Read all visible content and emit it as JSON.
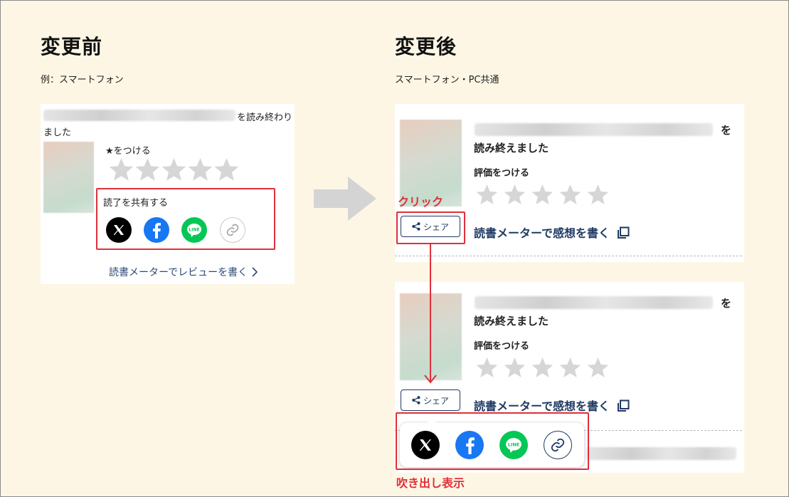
{
  "before": {
    "title": "変更前",
    "subtitle": "例：スマートフォン",
    "card": {
      "message_suffix": "を読み終わり",
      "message_line2": "ました",
      "rate_label": "★をつける",
      "share_label": "読了を共有する",
      "review_link": "読書メーターでレビューを書く"
    }
  },
  "after": {
    "title": "変更後",
    "subtitle": "スマートフォン・PC共通",
    "card": {
      "message_suffix": "を",
      "message_line2": "読み終えました",
      "rate_label": "評価をつける",
      "share_button": "シェア",
      "write_link": "読書メーターで感想を書く"
    },
    "click_label": "クリック",
    "balloon_label": "吹き出し表示"
  },
  "icons": [
    "x-icon",
    "facebook-icon",
    "line-icon",
    "link-icon",
    "share-icon",
    "star-icon",
    "copy-icon",
    "arrow-right-icon",
    "chevron-right-icon"
  ],
  "colors": {
    "background": "#fdf6e5",
    "highlight": "#e0303a",
    "link": "#1f3a63",
    "facebook": "#1877f2",
    "line": "#06c755",
    "star": "#d6d6d6"
  }
}
